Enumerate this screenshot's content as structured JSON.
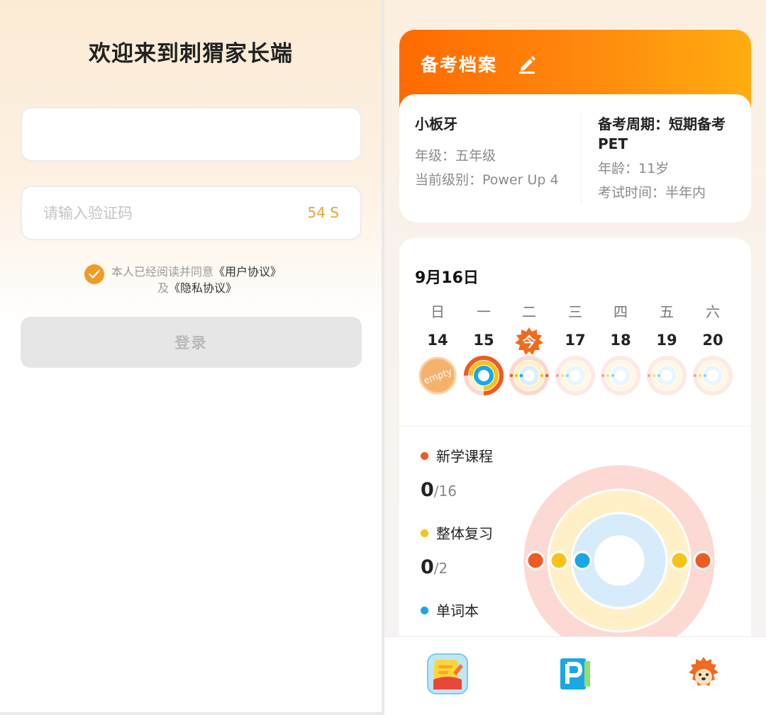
{
  "login": {
    "title": "欢迎来到刺猬家长端",
    "phone_value": "",
    "code_placeholder": "请输入验证码",
    "countdown": "54 S",
    "agree_prefix": "本人已经阅读并同意",
    "user_agreement": "《用户协议》",
    "agree_and": "及",
    "privacy_agreement": "《隐私协议》",
    "login_label": "登录"
  },
  "profile": {
    "title": "备考档案",
    "name": "小板牙",
    "grade": "年级：五年级",
    "level": "当前级别：Power Up 4",
    "cycle_line1": "备考周期：短期备考",
    "cycle_line2": "PET",
    "age": "年龄：11岁",
    "exam_time": "考试时间：半年内"
  },
  "calendar": {
    "date": "9月16日",
    "weekdays": [
      "日",
      "一",
      "二",
      "三",
      "四",
      "五",
      "六"
    ],
    "days": [
      "14",
      "15",
      "今",
      "17",
      "18",
      "19",
      "20"
    ],
    "empty_label": "empty"
  },
  "legend": {
    "new_course": "新学课程",
    "new_count": "0",
    "new_total": "/16",
    "review": "整体复习",
    "review_count": "0",
    "review_total": "/2",
    "vocab": "单词本"
  },
  "colors": {
    "accent": "#ff7a0a",
    "new_course": "#f05a24",
    "review": "#f7c21a",
    "vocab": "#1aa7e8",
    "countdown": "#e9a43a"
  },
  "icons": {
    "nav1": "study-plan-icon",
    "nav2": "p-book-icon",
    "nav3": "hedgehog-icon"
  }
}
